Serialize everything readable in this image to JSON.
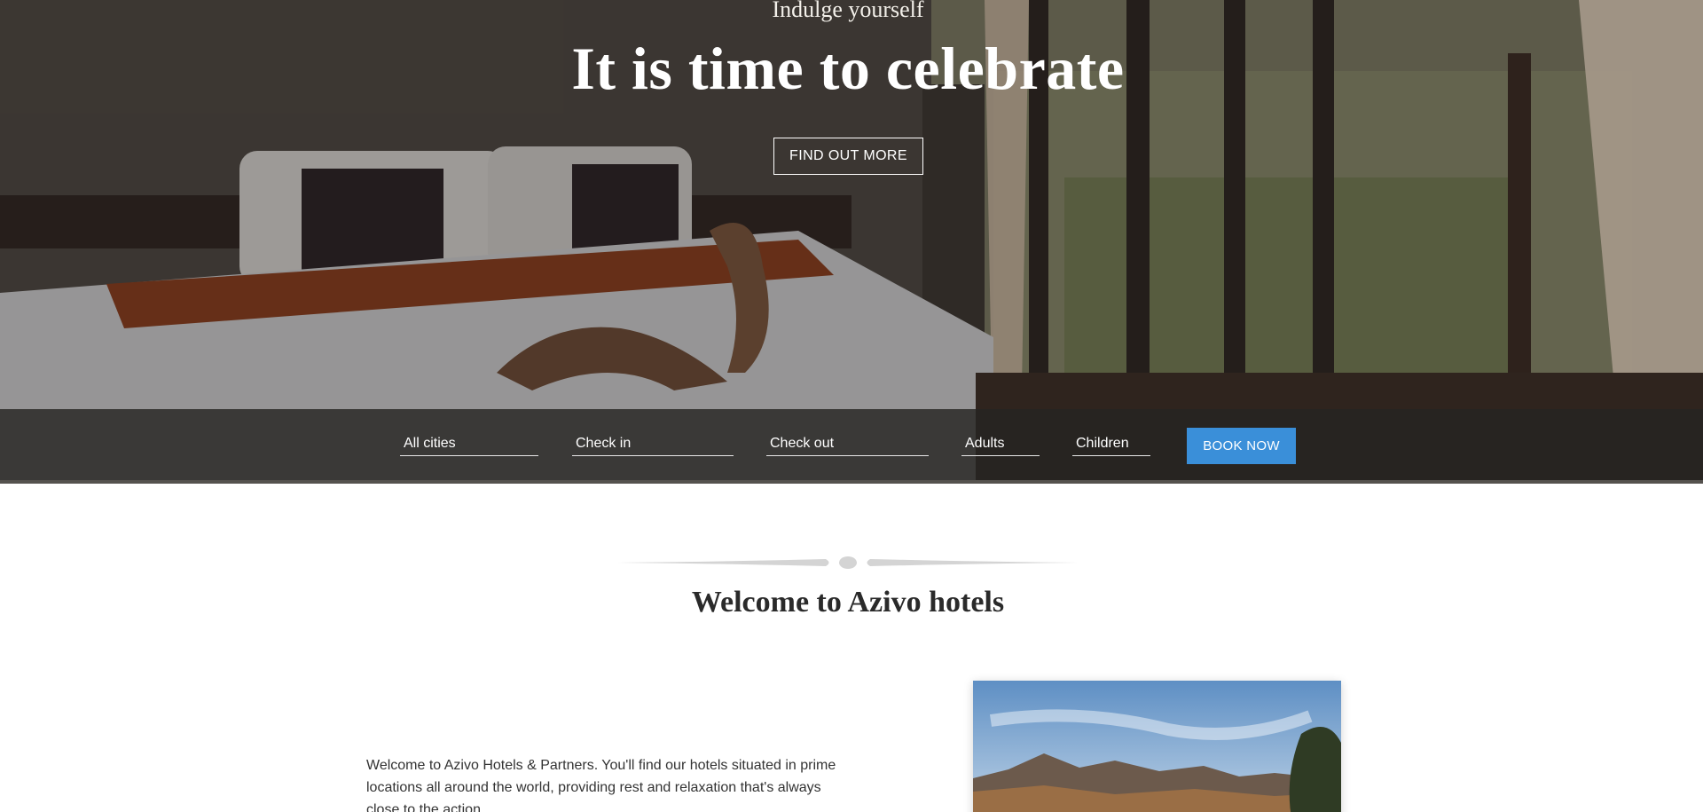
{
  "hero": {
    "kicker": "Indulge yourself",
    "title": "It is time to celebrate",
    "cta_label": "FIND OUT MORE"
  },
  "booking": {
    "city_field": "All cities",
    "checkin_field": "Check in",
    "checkout_field": "Check out",
    "adults_field": "Adults",
    "children_field": "Children",
    "book_label": "BOOK NOW"
  },
  "welcome": {
    "title": "Welcome to Azivo hotels",
    "intro": "Welcome to Azivo Hotels & Partners. You'll find our hotels situated in prime locations all around the world, providing rest and relaxation that's always close to the action."
  },
  "colors": {
    "accent": "#3a8fd9",
    "booking_bar": "#262422"
  },
  "icons": {
    "ornament": "divider-ornament-icon"
  }
}
